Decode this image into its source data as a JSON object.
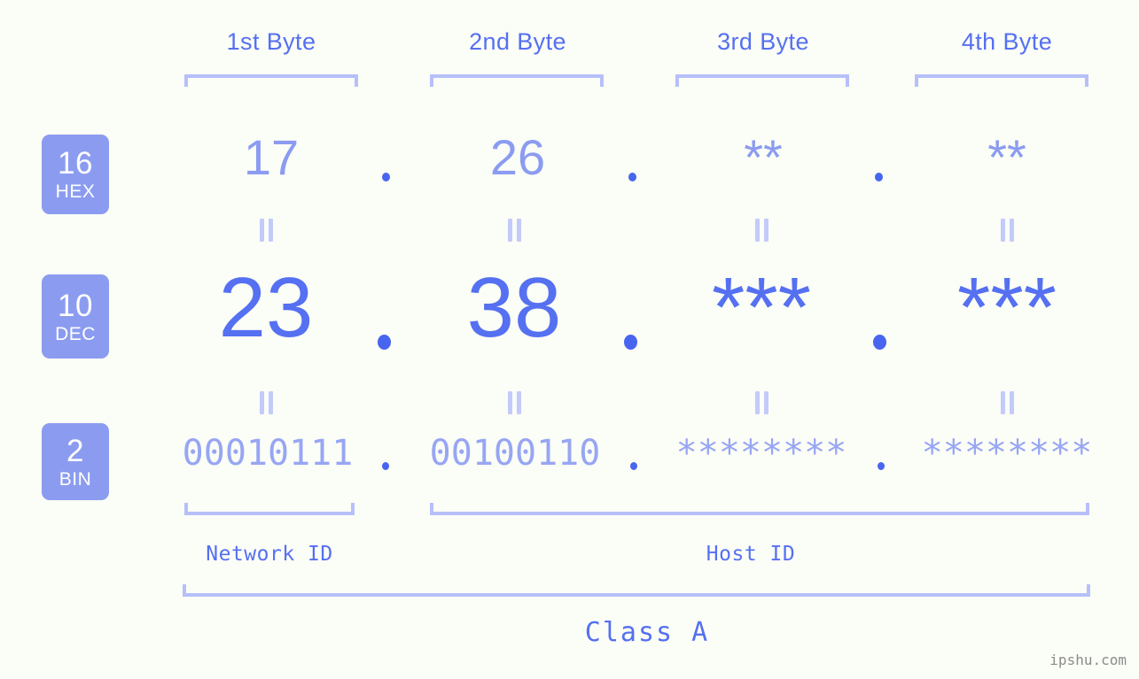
{
  "background_color": "#fbfdf7",
  "colors": {
    "accent_strong": "#5570f1",
    "accent_light": "#8b9cf0",
    "bracket": "#b6c0f9",
    "equals": "#c3cbfa",
    "dot": "#4865ef",
    "badge_bg": "#8b9cf0",
    "badge_text": "#ffffff",
    "watermark": "#8c8c8c"
  },
  "byte_headers": [
    {
      "label": "1st Byte"
    },
    {
      "label": "2nd Byte"
    },
    {
      "label": "3rd Byte"
    },
    {
      "label": "4th Byte"
    }
  ],
  "rows": [
    {
      "key": "hex",
      "badge": {
        "number": "16",
        "name": "HEX"
      },
      "octets": [
        "17",
        "26",
        "**",
        "**"
      ],
      "separator": "."
    },
    {
      "key": "dec",
      "badge": {
        "number": "10",
        "name": "DEC"
      },
      "octets": [
        "23",
        "38",
        "***",
        "***"
      ],
      "separator": "."
    },
    {
      "key": "bin",
      "badge": {
        "number": "2",
        "name": "BIN"
      },
      "octets": [
        "00010111",
        "00100110",
        "********",
        "********"
      ],
      "separator": "."
    }
  ],
  "equals_marks": {
    "glyph": "=",
    "count_per_gap": 4
  },
  "footer": {
    "network_id_label": "Network ID",
    "host_id_label": "Host ID",
    "class_label": "Class A"
  },
  "watermark": "ipshu.com"
}
